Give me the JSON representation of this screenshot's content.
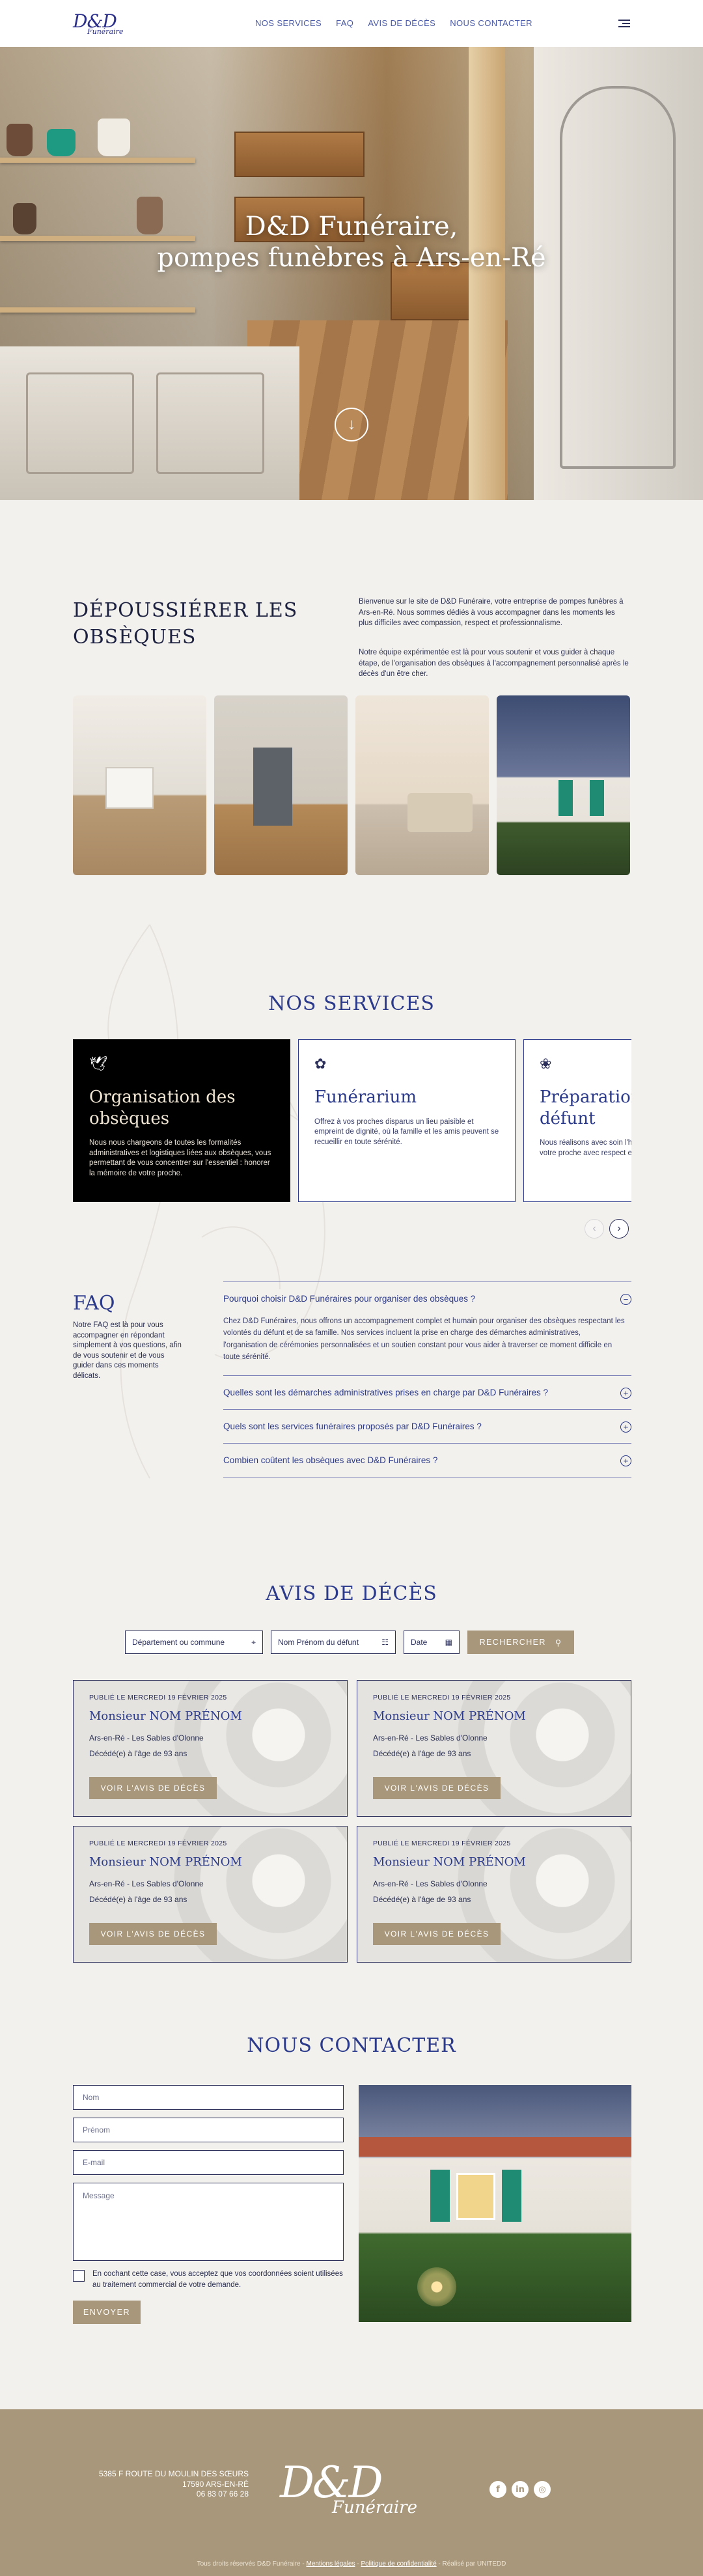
{
  "header": {
    "logo_mark": "D&D",
    "logo_sub": "Funéraire",
    "nav": [
      "NOS SERVICES",
      "FAQ",
      "AVIS DE DÉCÈS",
      "NOUS CONTACTER"
    ]
  },
  "hero": {
    "title_line1": "D&D Funéraire,",
    "title_line2": "pompes funèbres à Ars-en-Ré"
  },
  "intro": {
    "title": "DÉPOUSSIÉRER LES OBSÈQUES",
    "paragraph1": "Bienvenue sur le site de D&D Funéraire, votre entreprise de pompes funèbres à Ars-en-Ré. Nous sommes dédiés à vous accompagner dans les moments les plus difficiles avec compassion, respect et professionnalisme.",
    "paragraph2": "Notre équipe expérimentée est là pour vous soutenir et vous guider à chaque étape, de l'organisation des obsèques à l'accompagnement personnalisé après le décès d'un être cher."
  },
  "services": {
    "title": "NOS SERVICES",
    "cards": [
      {
        "icon": "dove-icon",
        "glyph": "🕊",
        "title": "Organisation des obsèques",
        "text": "Nous nous chargeons de toutes les formalités administratives et logistiques liées aux obsèques, vous permettant de vous concentrer sur l'essentiel : honorer la mémoire de votre proche."
      },
      {
        "icon": "flower-icon",
        "glyph": "✿",
        "title": "Funérarium",
        "text": "Offrez à vos proches disparus un lieu paisible et empreint de dignité, où la famille et les amis peuvent se recueillir en toute sérénité."
      },
      {
        "icon": "bouquet-icon",
        "glyph": "❀",
        "title": "Préparation du défunt",
        "text": "Nous réalisons avec soin l'habillage et le maquillage de votre proche avec respect et dignité."
      }
    ],
    "prev": "‹",
    "next": "›"
  },
  "faq": {
    "title": "FAQ",
    "intro": "Notre FAQ est là pour vous accompagner en répondant simplement à vos questions, afin de vous soutenir et de vous guider dans ces moments délicats.",
    "items": [
      {
        "q": "Pourquoi choisir D&D Funéraires pour organiser des obsèques ?",
        "a": "Chez D&D Funéraires, nous offrons un accompagnement complet et humain pour organiser des obsèques respectant les volontés du défunt et de sa famille. Nos services incluent la prise en charge des démarches administratives, l'organisation de cérémonies personnalisées et un soutien constant pour vous aider à traverser ce moment difficile en toute sérénité.",
        "toggle": "−"
      },
      {
        "q": "Quelles sont les démarches administratives prises en charge par D&D Funéraires ?",
        "toggle": "+"
      },
      {
        "q": "Quels sont les services funéraires proposés par D&D Funéraires ?",
        "toggle": "+"
      },
      {
        "q": "Combien coûtent les obsèques avec D&D Funéraires ?",
        "toggle": "+"
      }
    ]
  },
  "avis": {
    "title": "AVIS DE DÉCÈS",
    "search": {
      "commune_placeholder": "Département ou commune",
      "name_placeholder": "Nom Prénom du défunt",
      "date_placeholder": "Date",
      "button": "RECHERCHER"
    },
    "cards": [
      {
        "published": "PUBLIÉ LE MERCREDI 19 FÉVRIER 2025",
        "name": "Monsieur NOM PRÉNOM",
        "location": "Ars-en-Ré - Les Sables d'Olonne",
        "age": "Décédé(e) à l'âge de 93 ans",
        "button": "VOIR L'AVIS DE DÉCÈS"
      },
      {
        "published": "PUBLIÉ LE MERCREDI 19 FÉVRIER 2025",
        "name": "Monsieur NOM PRÉNOM",
        "location": "Ars-en-Ré - Les Sables d'Olonne",
        "age": "Décédé(e) à l'âge de 93 ans",
        "button": "VOIR L'AVIS DE DÉCÈS"
      },
      {
        "published": "PUBLIÉ LE MERCREDI 19 FÉVRIER 2025",
        "name": "Monsieur NOM PRÉNOM",
        "location": "Ars-en-Ré - Les Sables d'Olonne",
        "age": "Décédé(e) à l'âge de 93 ans",
        "button": "VOIR L'AVIS DE DÉCÈS"
      },
      {
        "published": "PUBLIÉ LE MERCREDI 19 FÉVRIER 2025",
        "name": "Monsieur NOM PRÉNOM",
        "location": "Ars-en-Ré - Les Sables d'Olonne",
        "age": "Décédé(e) à l'âge de 93 ans",
        "button": "VOIR L'AVIS DE DÉCÈS"
      }
    ]
  },
  "contact": {
    "title": "NOUS CONTACTER",
    "fields": {
      "nom": "Nom",
      "prenom": "Prénom",
      "email": "E-mail",
      "message": "Message"
    },
    "consent": "En cochant cette case, vous acceptez que vos coordonnées soient utilisées au traitement commercial de votre demande.",
    "send": "ENVOYER"
  },
  "footer": {
    "address_line1": "5385 F ROUTE DU MOULIN DES SŒURS",
    "address_line2": "17590 ARS-EN-RÉ",
    "phone": "06 83 07 66 28",
    "logo_mark": "D&D",
    "logo_sub": "Funéraire",
    "social": [
      "f",
      "in",
      "◎"
    ],
    "copyright": "Tous droits réservés D&D Funéraire - ",
    "legal": "Mentions légales",
    "privacy": "Politique de confidentialité",
    "credit": " - Réalisé par UNITEDD"
  },
  "colors": {
    "accent": "#a8977a",
    "navy": "#2b3a8a",
    "background": "#f3f1ee"
  }
}
